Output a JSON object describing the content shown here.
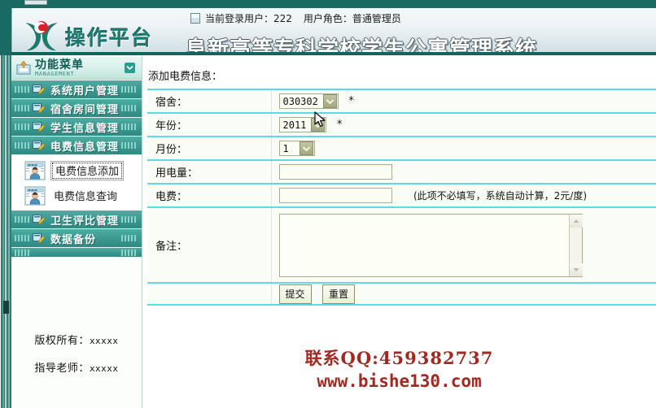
{
  "header": {
    "logo_text": "操作平台",
    "logo_icon": "company-logo-icon",
    "user_info_icon": "document-icon",
    "current_user_label": "当前登录用户：222",
    "user_role_label": "用户角色：普通管理员",
    "site_title": "阜新高等专科学校学生公寓管理系统"
  },
  "sidebar": {
    "menu_title": "功能菜单",
    "menu_subtitle": "MANAGEMENT",
    "collapse_icon": "chevron-down-icon",
    "menu_icon": "menu-box-icon",
    "items": [
      {
        "label": "系统用户管理",
        "icon": "edit-card-icon"
      },
      {
        "label": "宿舍房间管理",
        "icon": "edit-card-icon"
      },
      {
        "label": "学生信息管理",
        "icon": "edit-card-icon"
      },
      {
        "label": "电费信息管理",
        "icon": "edit-card-icon"
      }
    ],
    "submenu": [
      {
        "label": "电费信息添加",
        "icon": "user-card-icon",
        "active": true
      },
      {
        "label": "电费信息查询",
        "icon": "user-card-icon",
        "active": false
      }
    ],
    "items_after": [
      {
        "label": "卫生评比管理",
        "icon": "edit-card-icon"
      },
      {
        "label": "数据备份",
        "icon": "edit-card-icon"
      }
    ],
    "footer": {
      "copyright_label": "版权所有：",
      "copyright_value": "xxxxx",
      "advisor_label": "指导老师：",
      "advisor_value": "xxxxx"
    }
  },
  "main": {
    "heading": "添加电费信息：",
    "fields": {
      "dorm": {
        "label": "宿舍：",
        "value": "030302",
        "required_mark": "*",
        "options": [
          "030302"
        ]
      },
      "year": {
        "label": "年份：",
        "value": "2011",
        "required_mark": "*",
        "options": [
          "2011"
        ]
      },
      "month": {
        "label": "月份：",
        "value": "1",
        "options": [
          "1"
        ]
      },
      "usage": {
        "label": "用电量：",
        "value": "",
        "placeholder": ""
      },
      "fee": {
        "label": "电费：",
        "value": "",
        "placeholder": "",
        "note": "(此项不必填写，系统自动计算，2元/度)"
      },
      "remark": {
        "label": "备注：",
        "value": "",
        "placeholder": ""
      }
    },
    "buttons": {
      "submit_label": "提交",
      "reset_label": "重置"
    }
  },
  "contact": {
    "qq_line": "联系QQ:459382737",
    "site_line": "www.bishe130.com"
  },
  "colors": {
    "header_teal": "#186a62",
    "menu_teal": "#3d9b92",
    "table_border_cyan": "#5fd8e8",
    "contact_red": "#9e2a22",
    "logo_green": "#1d7a6e"
  }
}
